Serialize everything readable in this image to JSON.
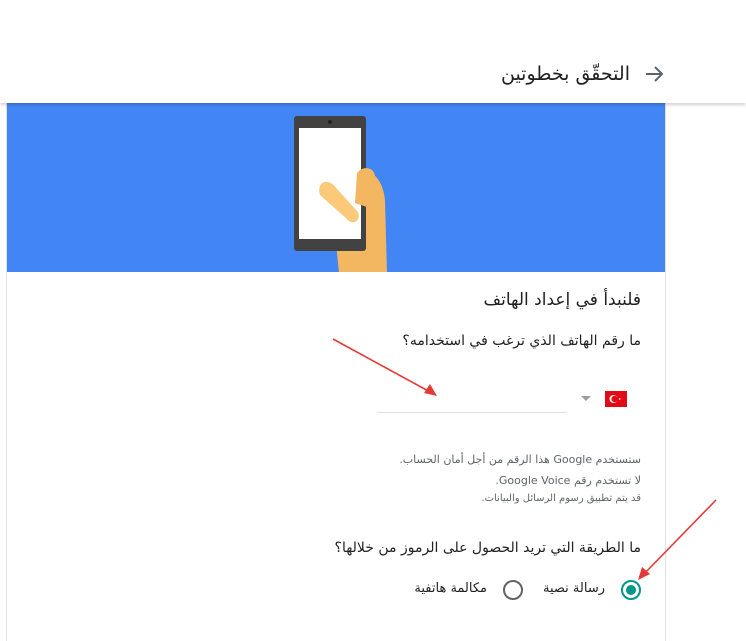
{
  "header": {
    "title": "التحقّق بخطوتين",
    "back_icon": "arrow-right-icon"
  },
  "setup": {
    "title": "فلنبدأ في إعداد الهاتف",
    "phone_question": "ما رقم الهاتف الذي ترغب في استخدامه؟"
  },
  "phone": {
    "country_icon": "turkey-flag-icon",
    "value": "",
    "placeholder": ""
  },
  "info": {
    "line1": "ستستخدم Google هذا الرقم من أجل أمان الحساب.",
    "line2": "لا تستخدم رقم Google Voice.",
    "line3": "قد يتم تطبيق رسوم الرسائل والبيانات."
  },
  "method": {
    "question": "ما الطريقة التي تريد الحصول على الرموز من خلالها؟",
    "options": [
      {
        "label": "رسالة نصية",
        "selected": true
      },
      {
        "label": "مكالمة هاتفية",
        "selected": false
      }
    ]
  },
  "colors": {
    "hero": "#4285f4",
    "radio_selected": "#009688",
    "annotation_arrow": "#e53935"
  }
}
